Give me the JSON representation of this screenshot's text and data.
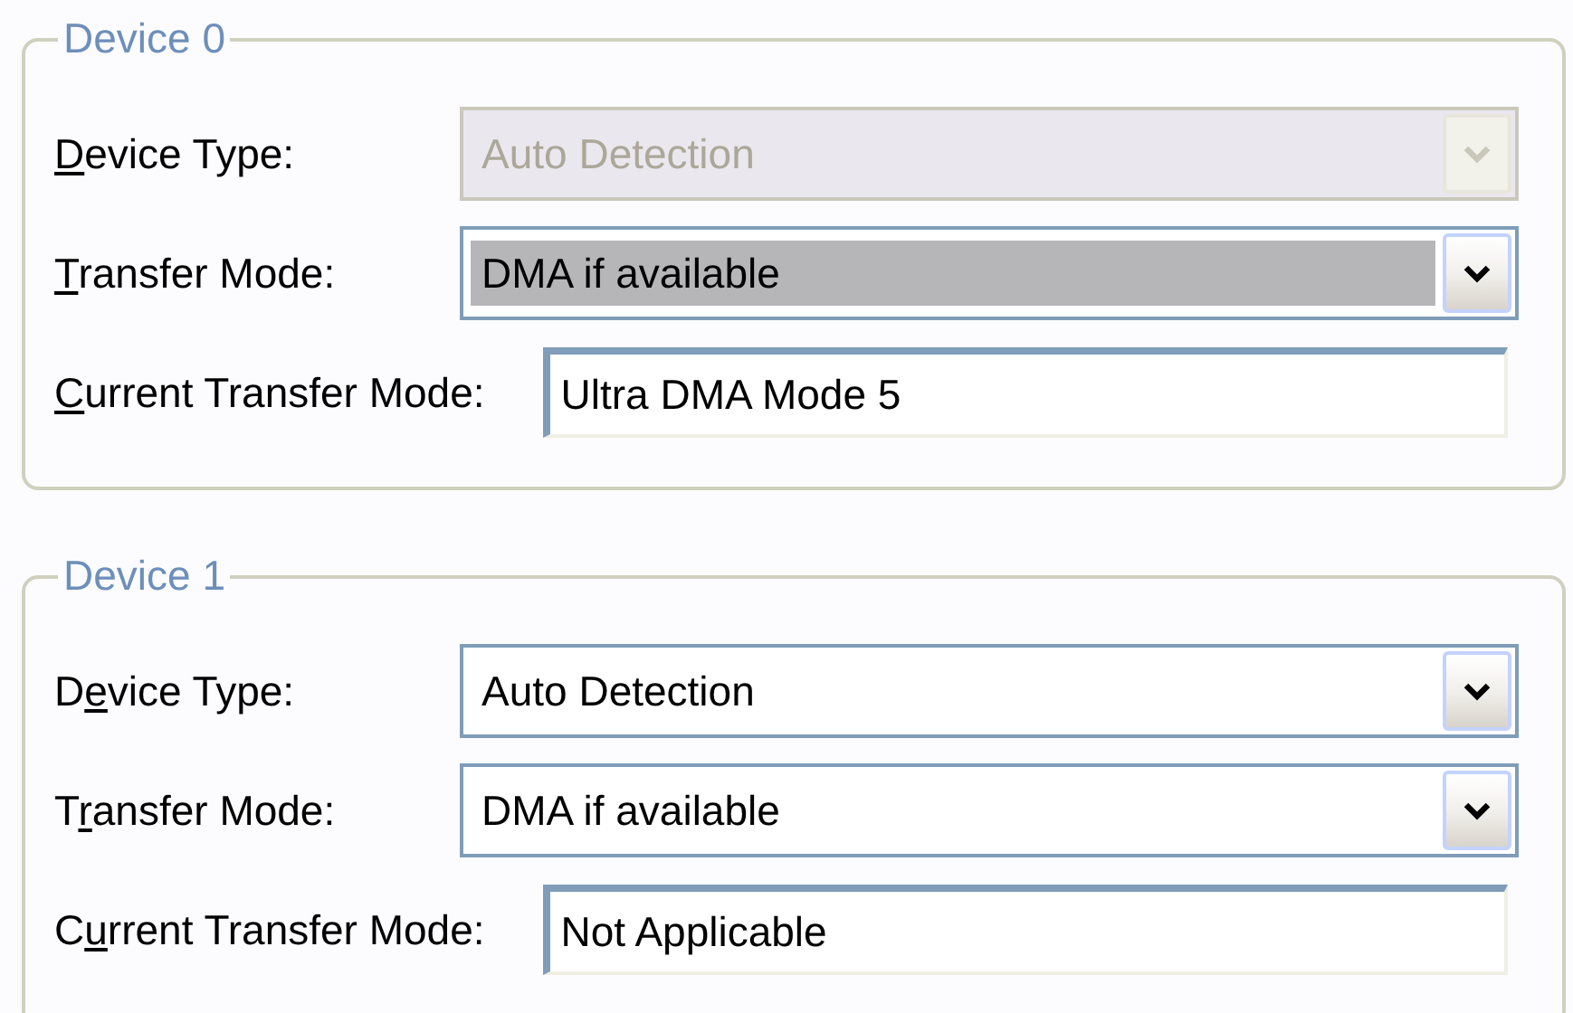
{
  "groups": [
    {
      "title": "Device 0",
      "fields": [
        {
          "kind": "combo",
          "access_key": "D",
          "label_after": "evice Type:",
          "value": "Auto Detection",
          "disabled": true,
          "highlighted": false
        },
        {
          "kind": "combo",
          "access_key": "T",
          "label_after": "ransfer Mode:",
          "value": "DMA if available",
          "disabled": false,
          "highlighted": true
        },
        {
          "kind": "text",
          "access_key": "C",
          "label_after": "urrent Transfer Mode:",
          "value": "Ultra DMA Mode 5"
        }
      ]
    },
    {
      "title": "Device 1",
      "fields": [
        {
          "kind": "combo",
          "label_before": "D",
          "access_key": "e",
          "label_after": "vice Type:",
          "value": "Auto Detection",
          "disabled": false,
          "highlighted": false
        },
        {
          "kind": "combo",
          "label_before": "T",
          "access_key": "r",
          "label_after": "ansfer Mode:",
          "value": "DMA if available",
          "disabled": false,
          "highlighted": false
        },
        {
          "kind": "text",
          "label_before": "C",
          "access_key": "u",
          "label_after": "rrent Transfer Mode:",
          "value": "Not Applicable"
        }
      ]
    }
  ]
}
